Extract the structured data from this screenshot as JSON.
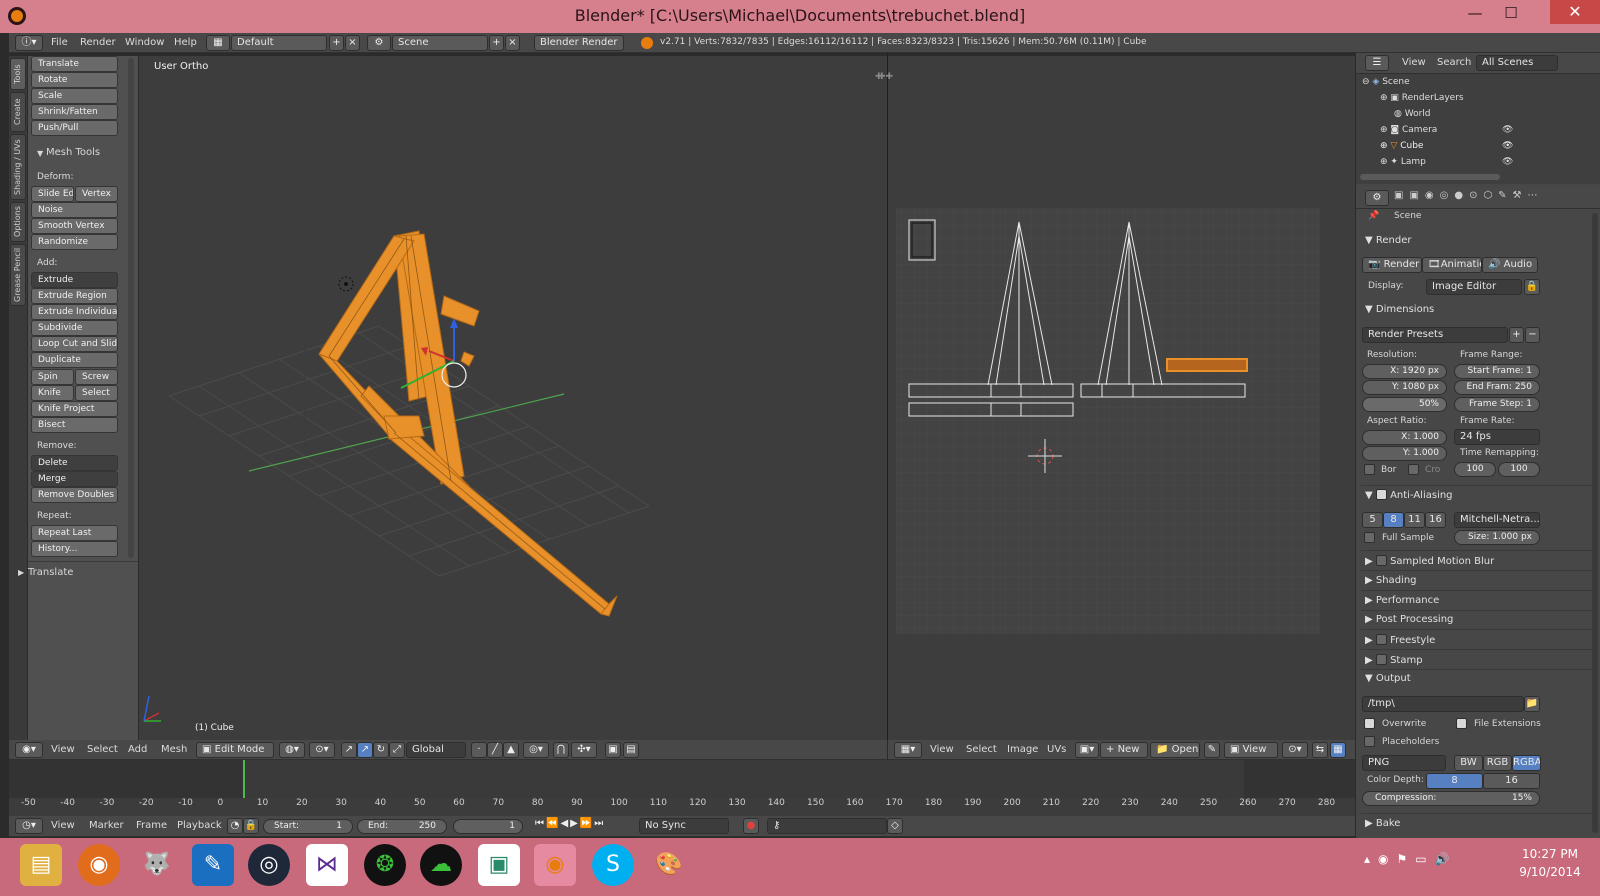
{
  "window": {
    "title": "Blender* [C:\\Users\\Michael\\Documents\\trebuchet.blend]",
    "minimize": "—",
    "maximize": "☐",
    "close": "✕"
  },
  "info_header": {
    "menus": [
      "File",
      "Render",
      "Window",
      "Help"
    ],
    "layout": "Default",
    "scene": "Scene",
    "engine": "Blender Render",
    "stats": "v2.71 | Verts:7832/7835 | Edges:16112/16112 | Faces:8323/8323 | Tris:15626 | Mem:50.76M (0.11M) | Cube"
  },
  "tool_tabs": [
    "Tools",
    "Create",
    "Shading / UVs",
    "Options",
    "Grease Pencil"
  ],
  "tool_shelf": {
    "transform_buttons": [
      "Translate",
      "Rotate",
      "Scale",
      "Shrink/Fatten",
      "Push/Pull"
    ],
    "mesh_tools_header": "Mesh Tools",
    "deform_label": "Deform:",
    "slide_edge": "Slide Ed",
    "vertex": "Vertex",
    "deform_buttons": [
      "Noise",
      "Smooth Vertex",
      "Randomize"
    ],
    "add_label": "Add:",
    "extrude_dropdown": "Extrude",
    "add_buttons": [
      "Extrude Region",
      "Extrude Individual",
      "Subdivide",
      "Loop Cut and Slide",
      "Duplicate"
    ],
    "spin": "Spin",
    "screw": "Screw",
    "knife": "Knife",
    "select": "Select",
    "knife_project": "Knife Project",
    "bisect": "Bisect",
    "remove_label": "Remove:",
    "delete_dropdown": "Delete",
    "merge_dropdown": "Merge",
    "remove_doubles": "Remove Doubles",
    "repeat_label": "Repeat:",
    "repeat_last": "Repeat Last",
    "history": "History...",
    "operator_panel": "Translate"
  },
  "viewport": {
    "view_name": "User Ortho",
    "object_label": "(1) Cube",
    "mesh_color": "#e8902a",
    "header": {
      "menus": [
        "View",
        "Select",
        "Add",
        "Mesh"
      ],
      "mode": "Edit Mode",
      "orientation": "Global"
    }
  },
  "uv_editor": {
    "header": {
      "menus": [
        "View",
        "Select",
        "Image",
        "UVs"
      ],
      "new": "New",
      "open": "Open",
      "view": "View"
    }
  },
  "outliner": {
    "header": {
      "view": "View",
      "search": "Search",
      "filter": "All Scenes"
    },
    "items": [
      "Scene",
      "RenderLayers",
      "World",
      "Camera",
      "Cube",
      "Lamp"
    ]
  },
  "properties": {
    "context": "Scene",
    "render_section": "Render",
    "render_btn": "Render",
    "animation_btn": "Animation",
    "audio_btn": "Audio",
    "display_label": "Display:",
    "display_value": "Image Editor",
    "dimensions_section": "Dimensions",
    "render_presets": "Render Presets",
    "resolution_label": "Resolution:",
    "res_x": "X:  1920 px",
    "res_y": "Y:  1080 px",
    "res_pct": "50%",
    "frame_range_label": "Frame Range:",
    "start_frame": "Start Frame: 1",
    "end_frame": "End Fram: 250",
    "frame_step": "Frame Step:  1",
    "aspect_label": "Aspect Ratio:",
    "aspect_x": "X:    1.000",
    "aspect_y": "Y:    1.000",
    "frame_rate_label": "Frame Rate:",
    "frame_rate": "24 fps",
    "time_remap_label": "Time Remapping:",
    "remap_old": "100",
    "remap_new": "100",
    "border": "Bor",
    "crop": "Cro",
    "aa_section": "Anti-Aliasing",
    "aa_samples": [
      "5",
      "8",
      "11",
      "16"
    ],
    "aa_filter": "Mitchell-Netra...",
    "full_sample": "Full Sample",
    "aa_size": "Size: 1.000 px",
    "collapsed_sections": [
      "Sampled Motion Blur",
      "Shading",
      "Performance",
      "Post Processing",
      "Freestyle",
      "Stamp"
    ],
    "output_section": "Output",
    "output_path": "/tmp\\",
    "overwrite": "Overwrite",
    "file_extensions": "File Extensions",
    "placeholders": "Placeholders",
    "format": "PNG",
    "bw": "BW",
    "rgb": "RGB",
    "rgba": "RGBA",
    "color_depth_label": "Color Depth:",
    "depth_8": "8",
    "depth_16": "16",
    "compression": "Compression:",
    "compression_value": "15%",
    "bake_section": "Bake",
    "accent": "#5680c2"
  },
  "timeline": {
    "ticks": [
      "-50",
      "-40",
      "-30",
      "-20",
      "-10",
      "0",
      "10",
      "20",
      "30",
      "40",
      "50",
      "60",
      "70",
      "80",
      "90",
      "100",
      "110",
      "120",
      "130",
      "140",
      "150",
      "160",
      "170",
      "180",
      "190",
      "200",
      "210",
      "220",
      "230",
      "240",
      "250",
      "260",
      "270",
      "280"
    ],
    "menus": [
      "View",
      "Marker",
      "Frame",
      "Playback"
    ],
    "start": "Start:",
    "start_value": "1",
    "end": "End:",
    "end_value": "250",
    "current": "1",
    "sync": "No Sync",
    "current_frame_color": "#4fb84f"
  },
  "taskbar": {
    "apps": [
      "file-explorer-icon",
      "firefox-icon",
      "gimp-icon",
      "pen-tool-icon",
      "steam-icon",
      "visual-studio-icon",
      "razer-icon",
      "cloud-icon",
      "window-app-icon",
      "blender-icon",
      "skype-icon",
      "paint-icon"
    ],
    "time": "10:27 PM",
    "date": "9/10/2014"
  }
}
